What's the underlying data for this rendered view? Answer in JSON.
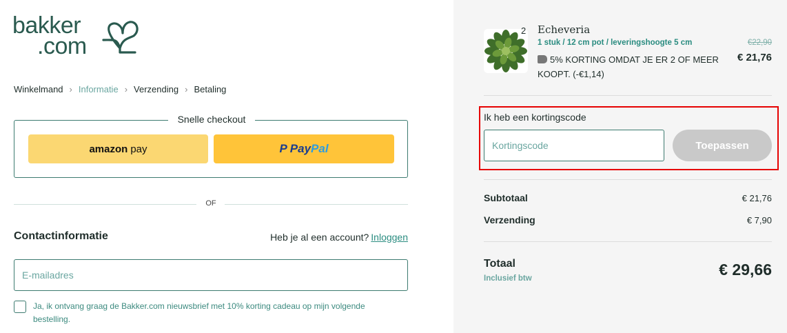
{
  "brand": {
    "line1": "bakker",
    "line2": ".com",
    "color": "#2a5a4f"
  },
  "breadcrumb": [
    "Winkelmand",
    "Informatie",
    "Verzending",
    "Betaling"
  ],
  "quick_checkout": {
    "title": "Snelle checkout",
    "amazon_label_bold": "amazon",
    "amazon_label": "pay",
    "paypal_icon": "P",
    "paypal_label1": "Pay",
    "paypal_label2": "Pal"
  },
  "or_label": "OF",
  "contact": {
    "title": "Contactinformatie",
    "account_text": "Heb je al een account?",
    "login_link": "Inloggen",
    "email_placeholder": "E-mailadres",
    "newsletter_text": "Ja, ik ontvang graag de Bakker.com nieuwsbrief met 10% korting cadeau op mijn volgende bestelling."
  },
  "order": {
    "product": {
      "quantity": "2",
      "name": "Echeveria",
      "subtitle": "1 stuk / 12 cm pot / leveringshoogte 5 cm",
      "discount": "5% KORTING OMDAT JE ER 2 OF MEER KOOPT. (-€1,14)",
      "old_price": "€22,90",
      "new_price": "€ 21,76",
      "image_icon": "succulent-icon"
    },
    "discount_code": {
      "label": "Ik heb een kortingscode",
      "placeholder": "Kortingscode",
      "apply_label": "Toepassen"
    },
    "subtotal_label": "Subtotaal",
    "subtotal_value": "€ 21,76",
    "shipping_label": "Verzending",
    "shipping_value": "€ 7,90",
    "total_label": "Totaal",
    "total_sub": "Inclusief btw",
    "total_value": "€ 29,66"
  },
  "colors": {
    "accent": "#3c7a6f",
    "link": "#2a8c80",
    "highlight": "#e60000",
    "amazon": "#fbd772",
    "paypal": "#ffc439"
  }
}
